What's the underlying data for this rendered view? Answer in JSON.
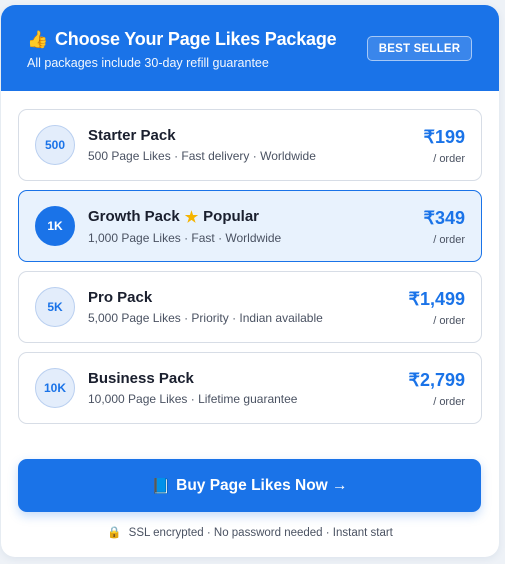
{
  "header": {
    "title": "Choose Your Page Likes Package",
    "subtitle": "All packages include 30-day refill guarantee",
    "badge": "BEST SELLER",
    "icon": "thumbs-up-icon"
  },
  "packages": [
    {
      "badge": "500",
      "name": "Starter Pack",
      "popular": "",
      "desc": "500 Page Likes · Fast delivery · Worldwide",
      "price": "₹199",
      "per": "/ order"
    },
    {
      "badge": "1K",
      "name": "Growth Pack",
      "popular": "Popular",
      "desc": "1,000 Page Likes · Fast · Worldwide",
      "price": "₹349",
      "per": "/ order"
    },
    {
      "badge": "5K",
      "name": "Pro Pack",
      "popular": "",
      "desc": "5,000 Page Likes · Priority · Indian available",
      "price": "₹1,499",
      "per": "/ order"
    },
    {
      "badge": "10K",
      "name": "Business Pack",
      "popular": "",
      "desc": "10,000 Page Likes · Lifetime guarantee",
      "price": "₹2,799",
      "per": "/ order"
    }
  ],
  "buy_button": {
    "label": "Buy Page Likes Now →",
    "icon": "book-icon"
  },
  "footer": {
    "text": "SSL encrypted · No password needed · Instant start",
    "icon": "lock-icon"
  },
  "colors": {
    "accent": "#1a73e8",
    "selected_bg": "#e8f2fd",
    "star": "#f5b400"
  }
}
